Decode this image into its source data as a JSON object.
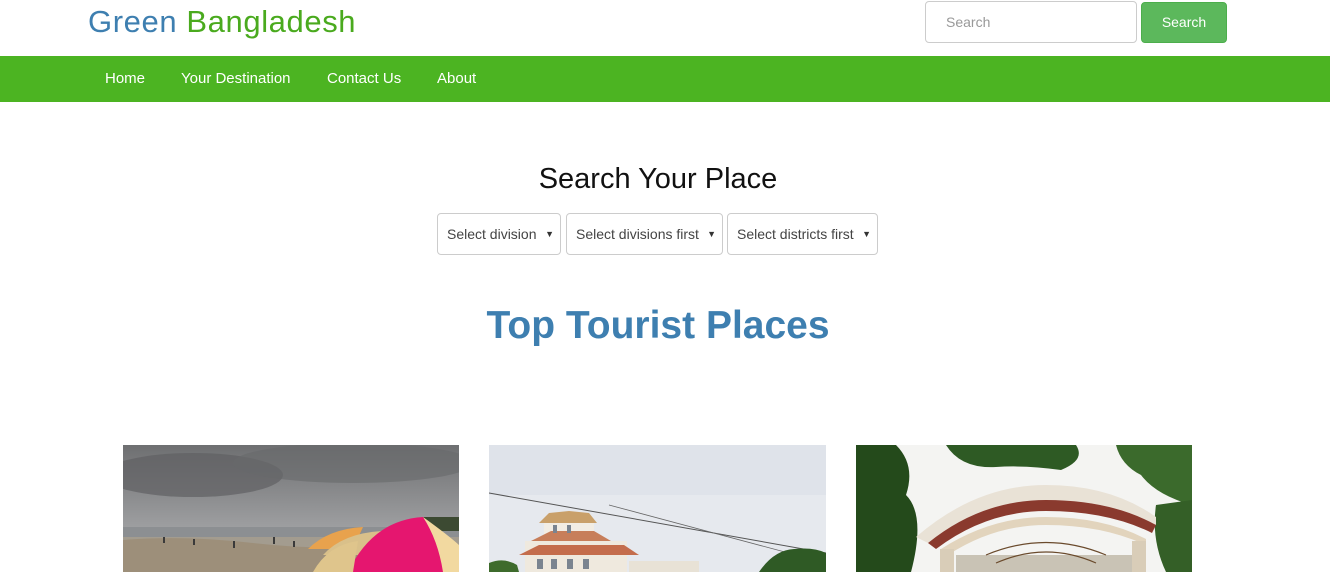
{
  "header": {
    "brand_word1": "Green",
    "brand_word2": "Bangladesh",
    "search_placeholder": "Search",
    "search_button": "Search"
  },
  "nav": {
    "items": [
      {
        "label": "Home"
      },
      {
        "label": "Your Destination"
      },
      {
        "label": "Contact Us"
      },
      {
        "label": "About"
      }
    ]
  },
  "search_section": {
    "title": "Search Your Place",
    "selects": [
      {
        "selected": "Select division"
      },
      {
        "selected": "Select divisions first"
      },
      {
        "selected": "Select districts first"
      }
    ]
  },
  "places_heading": "Top Tourist Places",
  "cards": [
    {
      "image": "beach-with-umbrellas-photo"
    },
    {
      "image": "white-building-photo"
    },
    {
      "image": "park-gate-with-trees-photo"
    }
  ],
  "colors": {
    "brand_blue": "#3e7fb0",
    "brand_green": "#4aaa1e",
    "nav_green": "#4cb422",
    "button_green": "#5cb85c"
  }
}
